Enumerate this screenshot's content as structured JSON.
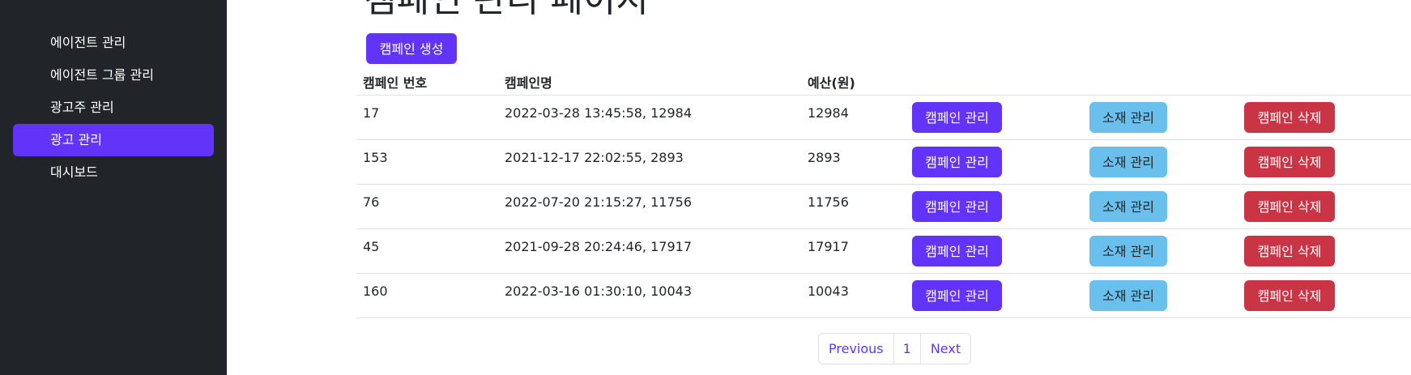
{
  "sidebar": {
    "items": [
      {
        "label": "에이전트 관리",
        "active": false
      },
      {
        "label": "에이전트 그룹 관리",
        "active": false
      },
      {
        "label": "광고주 관리",
        "active": false
      },
      {
        "label": "광고 관리",
        "active": true
      },
      {
        "label": "대시보드",
        "active": false
      }
    ]
  },
  "main": {
    "title": "캠페인 관리 페이지",
    "create_button": "캠페인 생성",
    "table": {
      "headers": [
        "캠페인 번호",
        "캠페인명",
        "예산(원)"
      ],
      "rows": [
        {
          "id": "17",
          "name": "2022-03-28 13:45:58, 12984",
          "budget": "12984"
        },
        {
          "id": "153",
          "name": "2021-12-17 22:02:55, 2893",
          "budget": "2893"
        },
        {
          "id": "76",
          "name": "2022-07-20 21:15:27, 11756",
          "budget": "11756"
        },
        {
          "id": "45",
          "name": "2021-09-28 20:24:46, 17917",
          "budget": "17917"
        },
        {
          "id": "160",
          "name": "2022-03-16 01:30:10, 10043",
          "budget": "10043"
        }
      ],
      "row_actions": {
        "manage": "캠페인 관리",
        "material": "소재 관리",
        "delete": "캠페인 삭제"
      }
    },
    "pagination": {
      "previous": "Previous",
      "current": "1",
      "next": "Next"
    }
  },
  "colors": {
    "sidebar_bg": "#212529",
    "primary": "#6233f9",
    "info": "#6ac0ed",
    "danger": "#c93545"
  }
}
